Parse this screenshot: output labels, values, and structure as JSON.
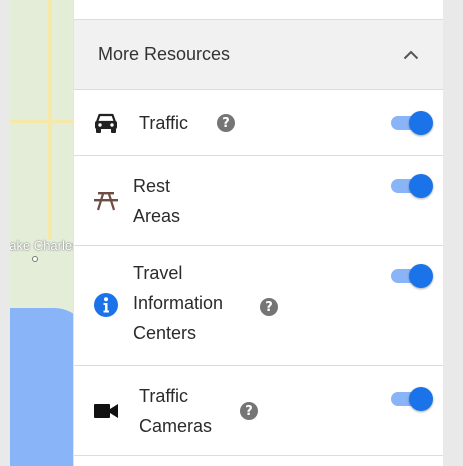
{
  "map": {
    "place_label": "Lake Charles"
  },
  "resources": {
    "header": {
      "title": "More Resources",
      "chevron_icon": "chevron-up-icon"
    },
    "items": [
      {
        "key": "traffic",
        "label_lines": [
          "Traffic"
        ],
        "icon": "car-icon",
        "has_help": true,
        "enabled": true
      },
      {
        "key": "rest-areas",
        "label_lines": [
          "Rest",
          "Areas"
        ],
        "icon": "picnic-table-icon",
        "has_help": false,
        "enabled": true
      },
      {
        "key": "travel-information-centers",
        "label_lines": [
          "Travel",
          "Information",
          "Centers"
        ],
        "icon": "info-icon",
        "has_help": true,
        "enabled": true
      },
      {
        "key": "traffic-cameras",
        "label_lines": [
          "Traffic",
          "Cameras"
        ],
        "icon": "camera-icon",
        "has_help": true,
        "enabled": true
      }
    ],
    "help_glyph": "?"
  },
  "colors": {
    "toggle_thumb": "#1a73e8",
    "toggle_track": "#8ab4f8",
    "info_icon": "#1a73e8",
    "rest_area_icon": "#6d4c41",
    "header_bg": "#f1f1f1"
  }
}
